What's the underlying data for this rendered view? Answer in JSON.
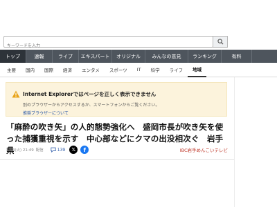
{
  "search": {
    "placeholder": "キーワードを入力"
  },
  "main_nav": [
    {
      "label": "トップ"
    },
    {
      "label": "速報"
    },
    {
      "label": "ライブ"
    },
    {
      "label": "エキスパート"
    },
    {
      "label": "オリジナル"
    },
    {
      "label": "みんなの意見"
    },
    {
      "label": "ランキング"
    },
    {
      "label": "有料"
    }
  ],
  "sub_nav": [
    {
      "label": "主要"
    },
    {
      "label": "国内"
    },
    {
      "label": "国際"
    },
    {
      "label": "経済"
    },
    {
      "label": "エンタメ"
    },
    {
      "label": "スポーツ"
    },
    {
      "label": "IT"
    },
    {
      "label": "科学"
    },
    {
      "label": "ライフ"
    },
    {
      "label": "地域"
    }
  ],
  "notice": {
    "title": "Internet Explorerではページを正しく表示できません",
    "text": "別のブラウザーからアクセスするか、スマートフォンからご覧ください。",
    "link": "推奨ブラウザーについて",
    "icon": "warning-icon",
    "color": "#fcf3dc"
  },
  "article": {
    "headline": "「麻酔の吹き矢」の人的態勢強化へ　盛岡市長が吹き矢を使った捕獲重視を示す　中心部などにクマの出没相次ぐ　岩手県",
    "date": "11/4(火) 21:49",
    "delivery": "配信",
    "comment_count": "139",
    "source": "IBC岩手めんこいテレビ",
    "source_color": "#c0392b"
  }
}
